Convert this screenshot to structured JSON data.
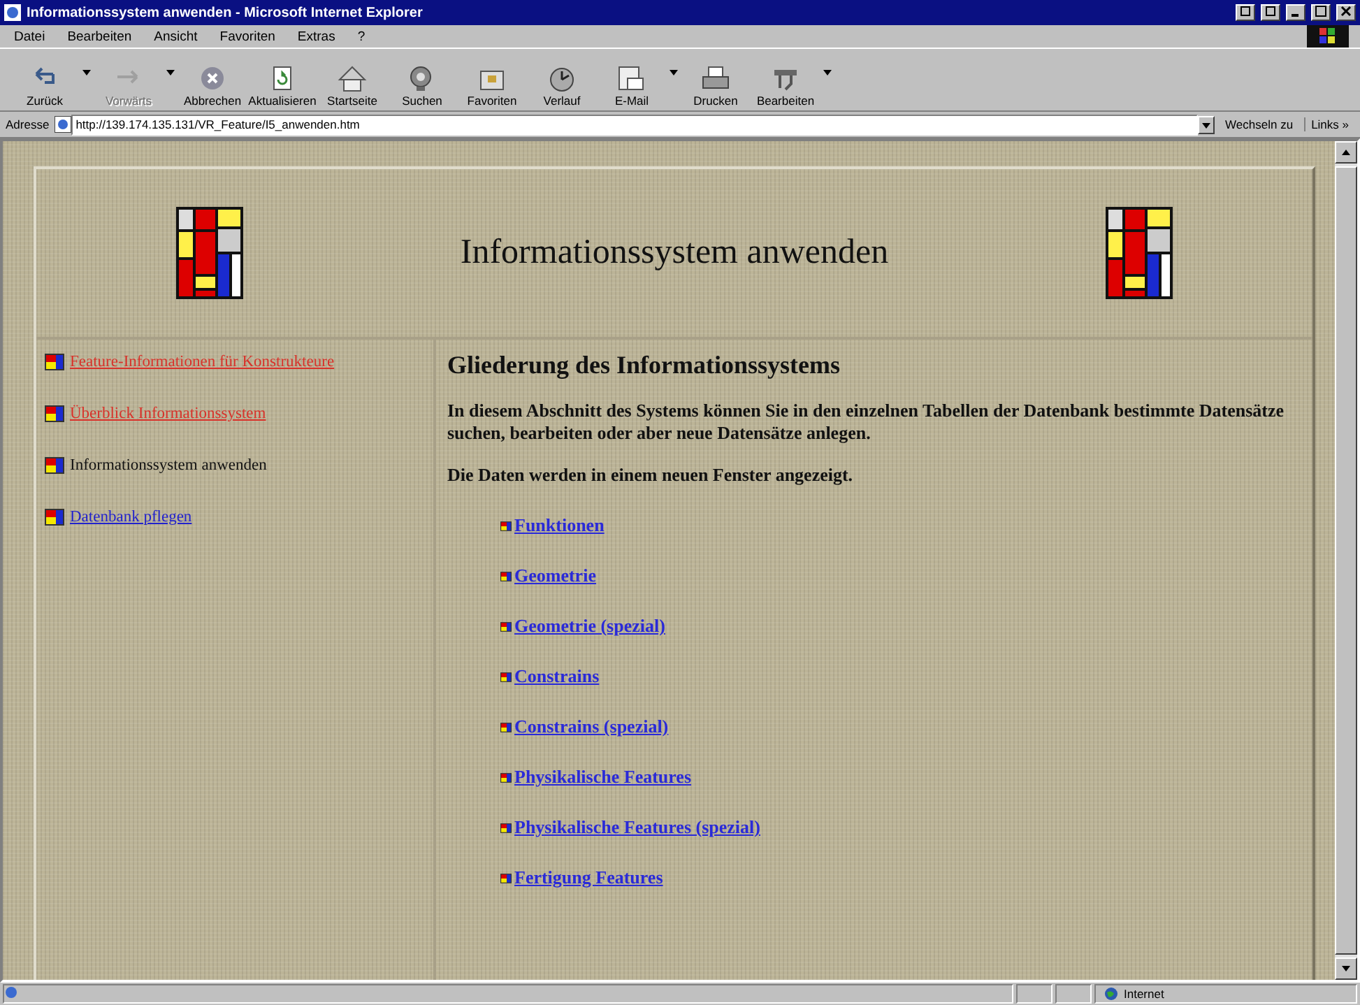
{
  "window": {
    "title": "Informationssystem anwenden - Microsoft Internet Explorer"
  },
  "menu": [
    "Datei",
    "Bearbeiten",
    "Ansicht",
    "Favoriten",
    "Extras",
    "?"
  ],
  "toolbar": [
    {
      "label": "Zurück",
      "kind": "back",
      "disabled": false,
      "dropdown": true
    },
    {
      "label": "Vorwärts",
      "kind": "forward",
      "disabled": true,
      "dropdown": true
    },
    {
      "label": "Abbrechen",
      "kind": "stop",
      "disabled": false,
      "dropdown": false
    },
    {
      "label": "Aktualisieren",
      "kind": "refresh",
      "disabled": false,
      "dropdown": false
    },
    {
      "label": "Startseite",
      "kind": "home",
      "disabled": false,
      "dropdown": false
    },
    {
      "label": "Suchen",
      "kind": "search",
      "disabled": false,
      "dropdown": false
    },
    {
      "label": "Favoriten",
      "kind": "favorites",
      "disabled": false,
      "dropdown": false
    },
    {
      "label": "Verlauf",
      "kind": "history",
      "disabled": false,
      "dropdown": false
    },
    {
      "label": "E-Mail",
      "kind": "mail",
      "disabled": false,
      "dropdown": true
    },
    {
      "label": "Drucken",
      "kind": "print",
      "disabled": false,
      "dropdown": false
    },
    {
      "label": "Bearbeiten",
      "kind": "edit",
      "disabled": false,
      "dropdown": true
    }
  ],
  "address_bar": {
    "label": "Adresse",
    "value": "http://139.174.135.131/VR_Feature/I5_anwenden.htm",
    "go": "Wechseln zu",
    "links": "Links »"
  },
  "page": {
    "title": "Informationssystem anwenden",
    "sidebar": [
      {
        "label": "Feature-Informationen für Konstrukteure",
        "kind": "visited"
      },
      {
        "label": "Überblick Informationssystem",
        "kind": "visited"
      },
      {
        "label": "Informationssystem anwenden",
        "kind": "current"
      },
      {
        "label": "Datenbank pflegen",
        "kind": "link"
      }
    ],
    "heading": "Gliederung des Informationssystems",
    "paragraphs": [
      "In diesem Abschnitt des Systems können Sie in den einzelnen Tabellen der Datenbank bestimmte Datensätze suchen, bearbeiten oder aber neue Datensätze anlegen.",
      "Die Daten werden in einem neuen Fenster angezeigt."
    ],
    "links": [
      "Funktionen",
      "Geometrie",
      "Geometrie (spezial)",
      "Constrains",
      "Constrains (spezial)",
      "Physikalische Features",
      "Physikalische Features (spezial)",
      "Fertigung Features"
    ]
  },
  "status_bar": {
    "zone": "Internet"
  }
}
